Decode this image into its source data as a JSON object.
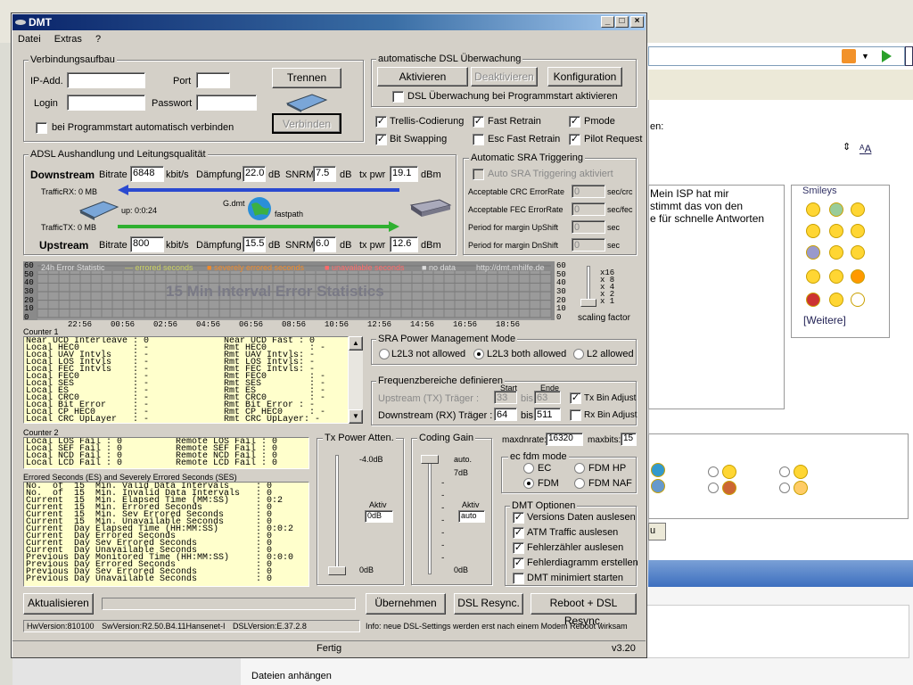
{
  "window": {
    "title": "DMT",
    "version": "v3.20",
    "status": "Fertig"
  },
  "menu": [
    "Datei",
    "Extras",
    "?"
  ],
  "verbindung": {
    "title": "Verbindungsaufbau",
    "ip_label": "IP-Add.",
    "port_label": "Port",
    "login_label": "Login",
    "pass_label": "Passwort",
    "trennen": "Trennen",
    "verbinden": "Verbinden",
    "autoconnect": "bei Programmstart automatisch verbinden"
  },
  "ueberwachung": {
    "title": "automatische DSL Überwachung",
    "aktivieren": "Aktivieren",
    "deaktivieren": "Deaktivieren",
    "konfiguration": "Konfiguration",
    "startcheck": "DSL Überwachung bei Programmstart aktivieren"
  },
  "options": {
    "trellis": "Trellis-Codierung",
    "fast_retrain": "Fast Retrain",
    "pmode": "Pmode",
    "bitswap": "Bit Swapping",
    "esc_fast": "Esc Fast Retrain",
    "pilot": "Pilot Request"
  },
  "adsl": {
    "title": "ADSL Aushandlung und Leitungsqualität",
    "downstream": "Downstream",
    "upstream": "Upstream",
    "bitrate": "Bitrate",
    "unit_kbit": "kbit/s",
    "daempfung": "Dämpfung",
    "db": "dB",
    "snrm": "SNRM",
    "txpwr": "tx pwr",
    "dbm": "dBm",
    "down_bitrate": "6848",
    "down_daempfung": "22.0",
    "down_snrm": "7.5",
    "down_txpwr": "19.1",
    "up_bitrate": "800",
    "up_daempfung": "15.5",
    "up_snrm": "6.0",
    "up_txpwr": "12.6",
    "traffic_rx": "TrafficRX: 0 MB",
    "traffic_tx": "TrafficTX: 0 MB",
    "uptime": "up: 0:0:24",
    "gdmt": "G.dmt",
    "fastpath": "fastpath"
  },
  "sra": {
    "title": "Automatic SRA Triggering",
    "auto": "Auto SRA Triggering aktiviert",
    "crc": "Acceptable CRC ErrorRate",
    "crc_unit": "sec/crc",
    "crc_val": "0",
    "fec": "Acceptable FEC ErrorRate",
    "fec_unit": "sec/fec",
    "fec_val": "0",
    "up": "Period for margin UpShift",
    "up_unit": "sec",
    "up_val": "0",
    "dn": "Period for margin DnShift",
    "dn_unit": "sec",
    "dn_val": "0"
  },
  "chart_data": {
    "type": "bar",
    "title": "15 Min Interval Error Statistics",
    "header": "24h Error Statistic",
    "legend": [
      "errored seconds",
      "severely errored seconds",
      "unavailable seconds",
      "no data"
    ],
    "url": "http://dmt.mhilfe.de",
    "x_ticks": [
      "22:56",
      "00:56",
      "02:56",
      "04:56",
      "06:56",
      "08:56",
      "10:56",
      "12:56",
      "14:56",
      "16:56",
      "18:56"
    ],
    "y_ticks": [
      "60",
      "50",
      "40",
      "30",
      "20",
      "10",
      "0"
    ],
    "ylim": [
      0,
      60
    ],
    "values": [],
    "scale_ticks": [
      "x16",
      "x 8",
      "x 4",
      "x 2",
      "x 1"
    ],
    "scale_label": "scaling factor"
  },
  "counter1": {
    "title": "Counter 1",
    "rows": [
      [
        "Near UCD Interleave : 0",
        "Near UCD Fast : 0"
      ],
      [
        "Local HEC0          : -",
        "Rmt HEC0        : -"
      ],
      [
        "Local UAV Intvls    : -",
        "Rmt UAV Intvls: -"
      ],
      [
        "Local LOS Intvls    : -",
        "Rmt LOS Intvls: -"
      ],
      [
        "Local FEC Intvls    : -",
        "Rmt FEC Intvls: -"
      ],
      [
        "Local FEC0          : -",
        "Rmt FEC0        : -"
      ],
      [
        "Local SES           : -",
        "Rmt SES         : -"
      ],
      [
        "Local ES            : -",
        "Rmt ES          : -"
      ],
      [
        "Local CRC0          : -",
        "Rmt CRC0        : -"
      ],
      [
        "Local Bit Error     : -",
        "Rmt Bit Error : -"
      ],
      [
        "Local CP HEC0       : -",
        "Rmt CP HEC0     : -"
      ],
      [
        "Local CRC UpLayer   : -",
        "Rmt CRC UpLayer: -"
      ]
    ]
  },
  "counter2": {
    "title": "Counter 2",
    "rows": [
      [
        "Local LOS Fail : 0",
        "Remote LOS Fail : 0"
      ],
      [
        "Local SEF Fail : 0",
        "Remote SEF Fail : 0"
      ],
      [
        "Local NCD Fail : 0",
        "Remote NCD Fail : 0"
      ],
      [
        "Local LCD Fail : 0",
        "Remote LCD Fail : 0"
      ]
    ]
  },
  "ses": {
    "title": "Errored Seconds (ES) and Severely Errored Seconds (SES)",
    "rows": [
      [
        "No.  of  15  Min. Valid Data Intervals",
        ": 0"
      ],
      [
        "No.  of  15  Min. Invalid Data Intervals",
        ": 0"
      ],
      [
        "Current  15  Min. Elapsed Time (MM:SS)",
        ": 0:2"
      ],
      [
        "Current  15  Min. Errored Seconds",
        ": 0"
      ],
      [
        "Current  15  Min. Sev Errored Seconds",
        ": 0"
      ],
      [
        "Current  15  Min. Unavailable Seconds",
        ": 0"
      ],
      [
        "Current  Day Elapsed Time (HH:MM:SS)",
        ": 0:0:2"
      ],
      [
        "Current  Day Errored Seconds",
        ": 0"
      ],
      [
        "Current  Day Sev Errored Seconds",
        ": 0"
      ],
      [
        "Current  Day Unavailable Seconds",
        ": 0"
      ],
      [
        "Previous Day Monitored Time (HH:MM:SS)",
        ": 0:0:0"
      ],
      [
        "Previous Day Errored Seconds",
        ": 0"
      ],
      [
        "Previous Day Sev Errored Seconds",
        ": 0"
      ],
      [
        "Previous Day Unavailable Seconds",
        ": 0"
      ]
    ]
  },
  "txpower": {
    "title": "Tx Power Atten.",
    "top": "-4.0dB",
    "bottom": "0dB",
    "aktiv": "Aktiv",
    "value": "0dB"
  },
  "coding": {
    "title": "Coding Gain",
    "auto": "auto.",
    "top": "7dB",
    "bottom": "0dB",
    "aktiv": "Aktiv",
    "value": "auto"
  },
  "sra_power": {
    "title": "SRA Power Management Mode",
    "opt1": "L2L3 not allowed",
    "opt2": "L2L3 both allowed",
    "opt3": "L2 allowed"
  },
  "freq": {
    "title": "Frequenzbereiche definieren",
    "start": "Start",
    "ende": "Ende",
    "bis": "bis",
    "upstream": "Upstream (TX) Träger :",
    "up_start": "33",
    "up_end": "63",
    "tx_bin": "Tx Bin Adjust",
    "downstream": "Downstream (RX) Träger :",
    "down_start": "64",
    "down_end": "511",
    "rx_bin": "Rx Bin Adjust"
  },
  "maxdn": {
    "label": "maxdnrate:",
    "value": "16320",
    "bits_label": "maxbits:",
    "bits_value": "15"
  },
  "fdm": {
    "title": "ec fdm mode",
    "ec": "EC",
    "fdm_hp": "FDM HP",
    "fdm": "FDM",
    "fdm_naf": "FDM NAF"
  },
  "dmt_opt": {
    "title": "DMT Optionen",
    "o1": "Versions Daten auslesen",
    "o2": "ATM Traffic auslesen",
    "o3": "Fehlerzähler auslesen",
    "o4": "Fehlerdiagramm erstellen",
    "o5": "DMT minimiert starten"
  },
  "bottom": {
    "aktualisieren": "Aktualisieren",
    "uebernehmen": "Übernehmen",
    "dsl_resync": "DSL Resync.",
    "reboot": "Reboot + DSL Resync.",
    "hw": "HwVersion:810100",
    "sw": "SwVersion:R2.50.B4.11Hansenet-I",
    "dsl": "DSLVersion:E.37.2.8",
    "info": "Info: neue DSL-Settings werden erst nach einem Modem Reboot wirksam"
  },
  "background": {
    "label_en": "en:",
    "text": "Mein ISP hat mir\nstimmt das von den\ne für schnelle Antworten",
    "smileys": "Smileys",
    "weitere": "[Weitere]",
    "btn_u": "u",
    "dateien": "Dateien anhängen"
  }
}
